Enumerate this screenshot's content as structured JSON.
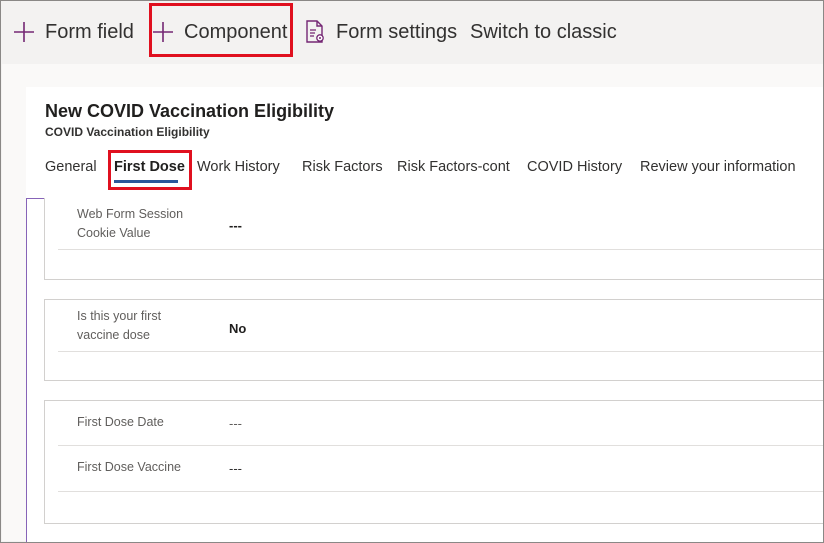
{
  "toolbar": {
    "form_field": "Form field",
    "component": "Component",
    "form_settings": "Form settings",
    "switch_classic": "Switch to classic"
  },
  "form": {
    "title": "New COVID Vaccination Eligibility",
    "subtitle": "COVID Vaccination Eligibility"
  },
  "tabs": [
    "General",
    "First Dose",
    "Work History",
    "Risk Factors",
    "Risk Factors-cont",
    "COVID History",
    "Review your information"
  ],
  "fields": {
    "cookie_label_1": "Web Form Session",
    "cookie_label_2": "Cookie Value",
    "cookie_value": "---",
    "first_dose_q_1": "Is this your first",
    "first_dose_q_2": "vaccine dose",
    "first_dose_q_value": "No",
    "date_label": "First Dose Date",
    "date_value": "---",
    "vaccine_label": "First Dose Vaccine",
    "vaccine_value": "---"
  },
  "colors": {
    "accent": "#742774",
    "highlight": "#e0101f",
    "tab_underline": "#2b579a"
  }
}
